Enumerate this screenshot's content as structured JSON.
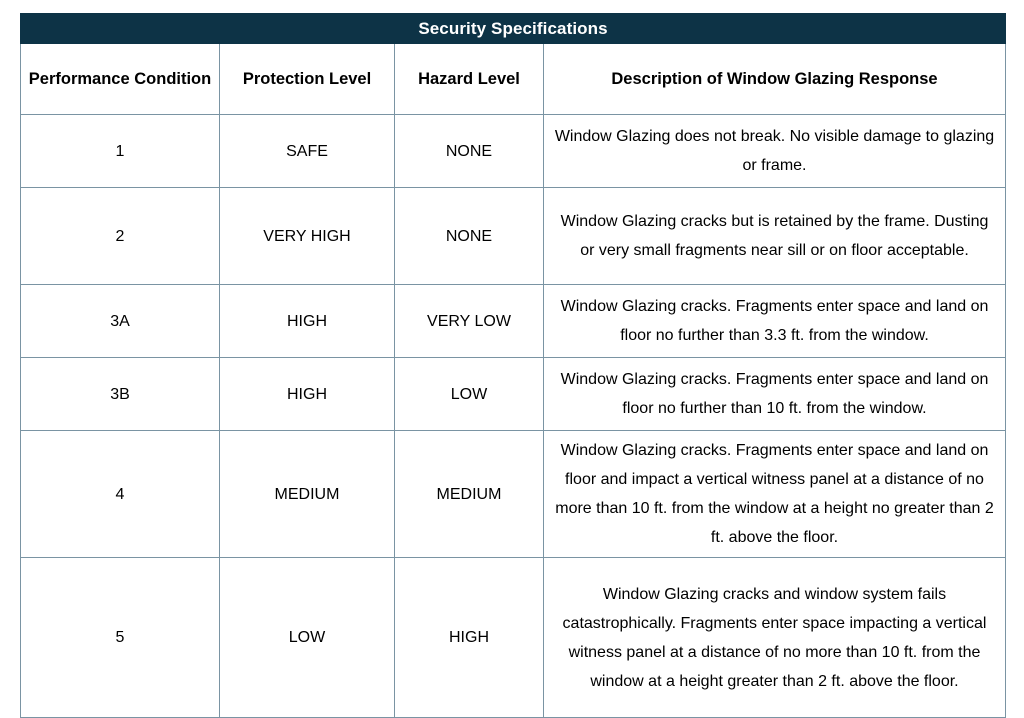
{
  "table": {
    "title": "Security Specifications",
    "accent_color": "#0d3346",
    "grid_color": "#7a94a3",
    "title_text_color": "#ffffff",
    "columns": [
      {
        "id": "performance_condition",
        "label": "Performance Condition"
      },
      {
        "id": "protection_level",
        "label": "Protection Level"
      },
      {
        "id": "hazard_level",
        "label": "Hazard Level"
      },
      {
        "id": "description",
        "label": "Description of Window Glazing Response"
      }
    ],
    "rows": [
      {
        "performance_condition": "1",
        "protection_level": "SAFE",
        "hazard_level": "NONE",
        "description": "Window Glazing does not break. No visible damage to glazing or frame."
      },
      {
        "performance_condition": "2",
        "protection_level": "VERY HIGH",
        "hazard_level": "NONE",
        "description": "Window Glazing cracks but is retained by the frame. Dusting or very small fragments near sill or on floor acceptable."
      },
      {
        "performance_condition": "3A",
        "protection_level": "HIGH",
        "hazard_level": "VERY LOW",
        "description": "Window Glazing cracks. Fragments enter space and land on floor no further than 3.3 ft. from the window."
      },
      {
        "performance_condition": "3B",
        "protection_level": "HIGH",
        "hazard_level": "LOW",
        "description": "Window Glazing cracks. Fragments enter space and land on floor no further than 10 ft. from the window."
      },
      {
        "performance_condition": "4",
        "protection_level": "MEDIUM",
        "hazard_level": "MEDIUM",
        "description": "Window Glazing cracks. Fragments enter space and land on floor and impact a vertical witness panel at a distance of no more than 10 ft. from the window at a height no greater than 2 ft. above the floor."
      },
      {
        "performance_condition": "5",
        "protection_level": "LOW",
        "hazard_level": "HIGH",
        "description": "Window Glazing cracks and window system fails catastrophically. Fragments enter space impacting a vertical witness panel at a distance of no more than 10 ft. from the window at a height greater than 2 ft. above the floor."
      }
    ]
  }
}
